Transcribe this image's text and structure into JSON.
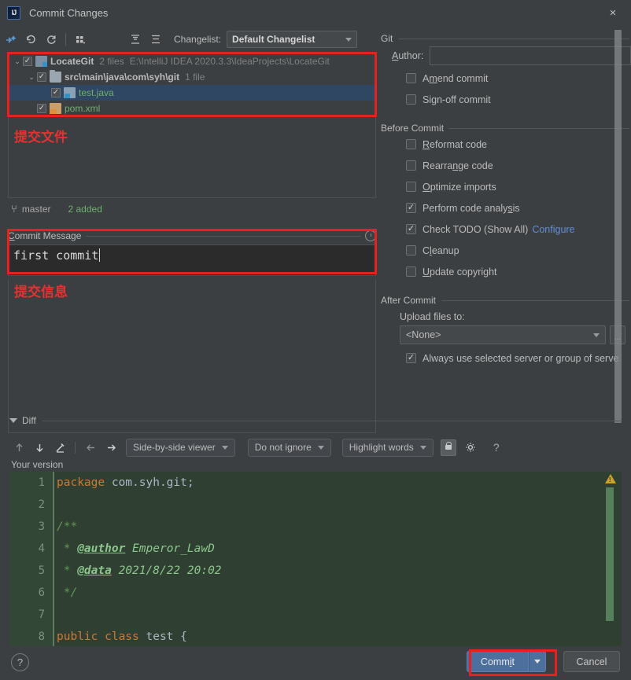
{
  "window": {
    "title": "Commit Changes",
    "logo_text": "IJ",
    "close_icon": "×"
  },
  "toolbar": {
    "icons": [
      "magic-diff-icon",
      "revert-icon",
      "refresh-icon",
      "group-by-icon",
      "expand-all-icon",
      "collapse-all-icon"
    ],
    "changelist_label": "Changelist:",
    "changelist_value": "Default Changelist"
  },
  "file_tree": {
    "rows": [
      {
        "name": "LocateGit",
        "meta": "2 files",
        "path": "E:\\IntelliJ IDEA 2020.3.3\\IdeaProjects\\LocateGit",
        "checked": true,
        "expanded": true,
        "level": 0,
        "icon": "module-icon",
        "selected": false,
        "is_file": false
      },
      {
        "name": "src\\main\\java\\com\\syh\\git",
        "meta": "1 file",
        "path": "",
        "checked": true,
        "expanded": true,
        "level": 1,
        "icon": "folder-icon",
        "selected": false,
        "is_file": false
      },
      {
        "name": "test.java",
        "meta": "",
        "path": "",
        "checked": true,
        "expanded": null,
        "level": 2,
        "icon": "java-file-icon",
        "selected": true,
        "is_file": true
      },
      {
        "name": "pom.xml",
        "meta": "",
        "path": "",
        "checked": true,
        "expanded": null,
        "level": 1,
        "icon": "xml-file-icon",
        "selected": false,
        "is_file": true
      }
    ],
    "status": {
      "branch_icon": "branch-icon",
      "branch": "master",
      "added": "2 added"
    }
  },
  "annotations": {
    "files_note": "提交文件",
    "message_note": "提交信息",
    "accent_color": "#e82020"
  },
  "commit_message": {
    "label_underlined": "C",
    "label_rest": "ommit Message",
    "history_icon": "history-clock-icon",
    "value": "first commit"
  },
  "right_panel": {
    "git": {
      "group_label": "Git",
      "author_label_underlined": "A",
      "author_label_rest": "uthor:",
      "author_value": "",
      "options": [
        {
          "pre": "A",
          "u": "m",
          "post": "end commit",
          "checked": false,
          "name": "amend-commit"
        },
        {
          "pre": "Si",
          "u": "g",
          "post": "n-off commit",
          "checked": false,
          "name": "sign-off-commit"
        }
      ]
    },
    "before_commit": {
      "group_label": "Before Commit",
      "options": [
        {
          "pre": "",
          "u": "R",
          "post": "eformat code",
          "checked": false,
          "name": "reformat-code"
        },
        {
          "pre": "Rearra",
          "u": "n",
          "post": "ge code",
          "checked": false,
          "name": "rearrange-code"
        },
        {
          "pre": "",
          "u": "O",
          "post": "ptimize imports",
          "checked": false,
          "name": "optimize-imports"
        },
        {
          "pre": "Perform code analy",
          "u": "s",
          "post": "is",
          "checked": true,
          "name": "perform-code-analysis"
        },
        {
          "pre": "Check TODO (Show All)",
          "u": "",
          "post": "",
          "checked": true,
          "name": "check-todo",
          "link": "Configure"
        },
        {
          "pre": "C",
          "u": "l",
          "post": "eanup",
          "checked": false,
          "name": "cleanup"
        },
        {
          "pre": "",
          "u": "U",
          "post": "pdate copyright",
          "checked": false,
          "name": "update-copyright"
        }
      ]
    },
    "after_commit": {
      "group_label": "After Commit",
      "upload_label": "Upload files to:",
      "upload_value": "<None>",
      "upload_more_button": "...",
      "always_use_label": "Always use selected server or group of serve",
      "always_use_checked": true
    }
  },
  "diff": {
    "section_label": "Diff",
    "toolbar": {
      "icons": [
        "prev-difference-icon",
        "next-difference-icon",
        "annotate-icon",
        "apply-left-icon",
        "apply-right-icon",
        "lock-icon",
        "settings-gear-icon",
        "help-icon"
      ],
      "viewer_mode": "Side-by-side viewer",
      "ignore_mode": "Do not ignore",
      "highlight_mode": "Highlight words",
      "help_glyph": "?"
    },
    "your_version_label": "Your version",
    "warning_icon": "warning-triangle-icon",
    "code_lines": [
      {
        "n": "1",
        "tokens": [
          {
            "t": "package",
            "c": "kw"
          },
          {
            "t": " com.syh.git;",
            "c": "plain"
          }
        ]
      },
      {
        "n": "2",
        "tokens": []
      },
      {
        "n": "3",
        "tokens": [
          {
            "t": "/**",
            "c": "cmt"
          }
        ]
      },
      {
        "n": "4",
        "tokens": [
          {
            "t": " * ",
            "c": "cmt"
          },
          {
            "t": "@author",
            "c": "tag"
          },
          {
            "t": " Emperor_LawD",
            "c": "cmt-txt"
          }
        ]
      },
      {
        "n": "5",
        "tokens": [
          {
            "t": " * ",
            "c": "cmt"
          },
          {
            "t": "@data",
            "c": "tag"
          },
          {
            "t": " 2021/8/22 20:02",
            "c": "cmt-txt"
          }
        ]
      },
      {
        "n": "6",
        "tokens": [
          {
            "t": " */",
            "c": "cmt"
          }
        ]
      },
      {
        "n": "7",
        "tokens": []
      },
      {
        "n": "8",
        "tokens": [
          {
            "t": "public class",
            "c": "kw"
          },
          {
            "t": " test {",
            "c": "plain"
          }
        ]
      }
    ]
  },
  "bottom": {
    "help_glyph": "?",
    "commit_pre": "Comm",
    "commit_u": "i",
    "commit_post": "t",
    "commit_dropdown_icon": "chevron-down-icon",
    "cancel_label": "Cancel"
  }
}
